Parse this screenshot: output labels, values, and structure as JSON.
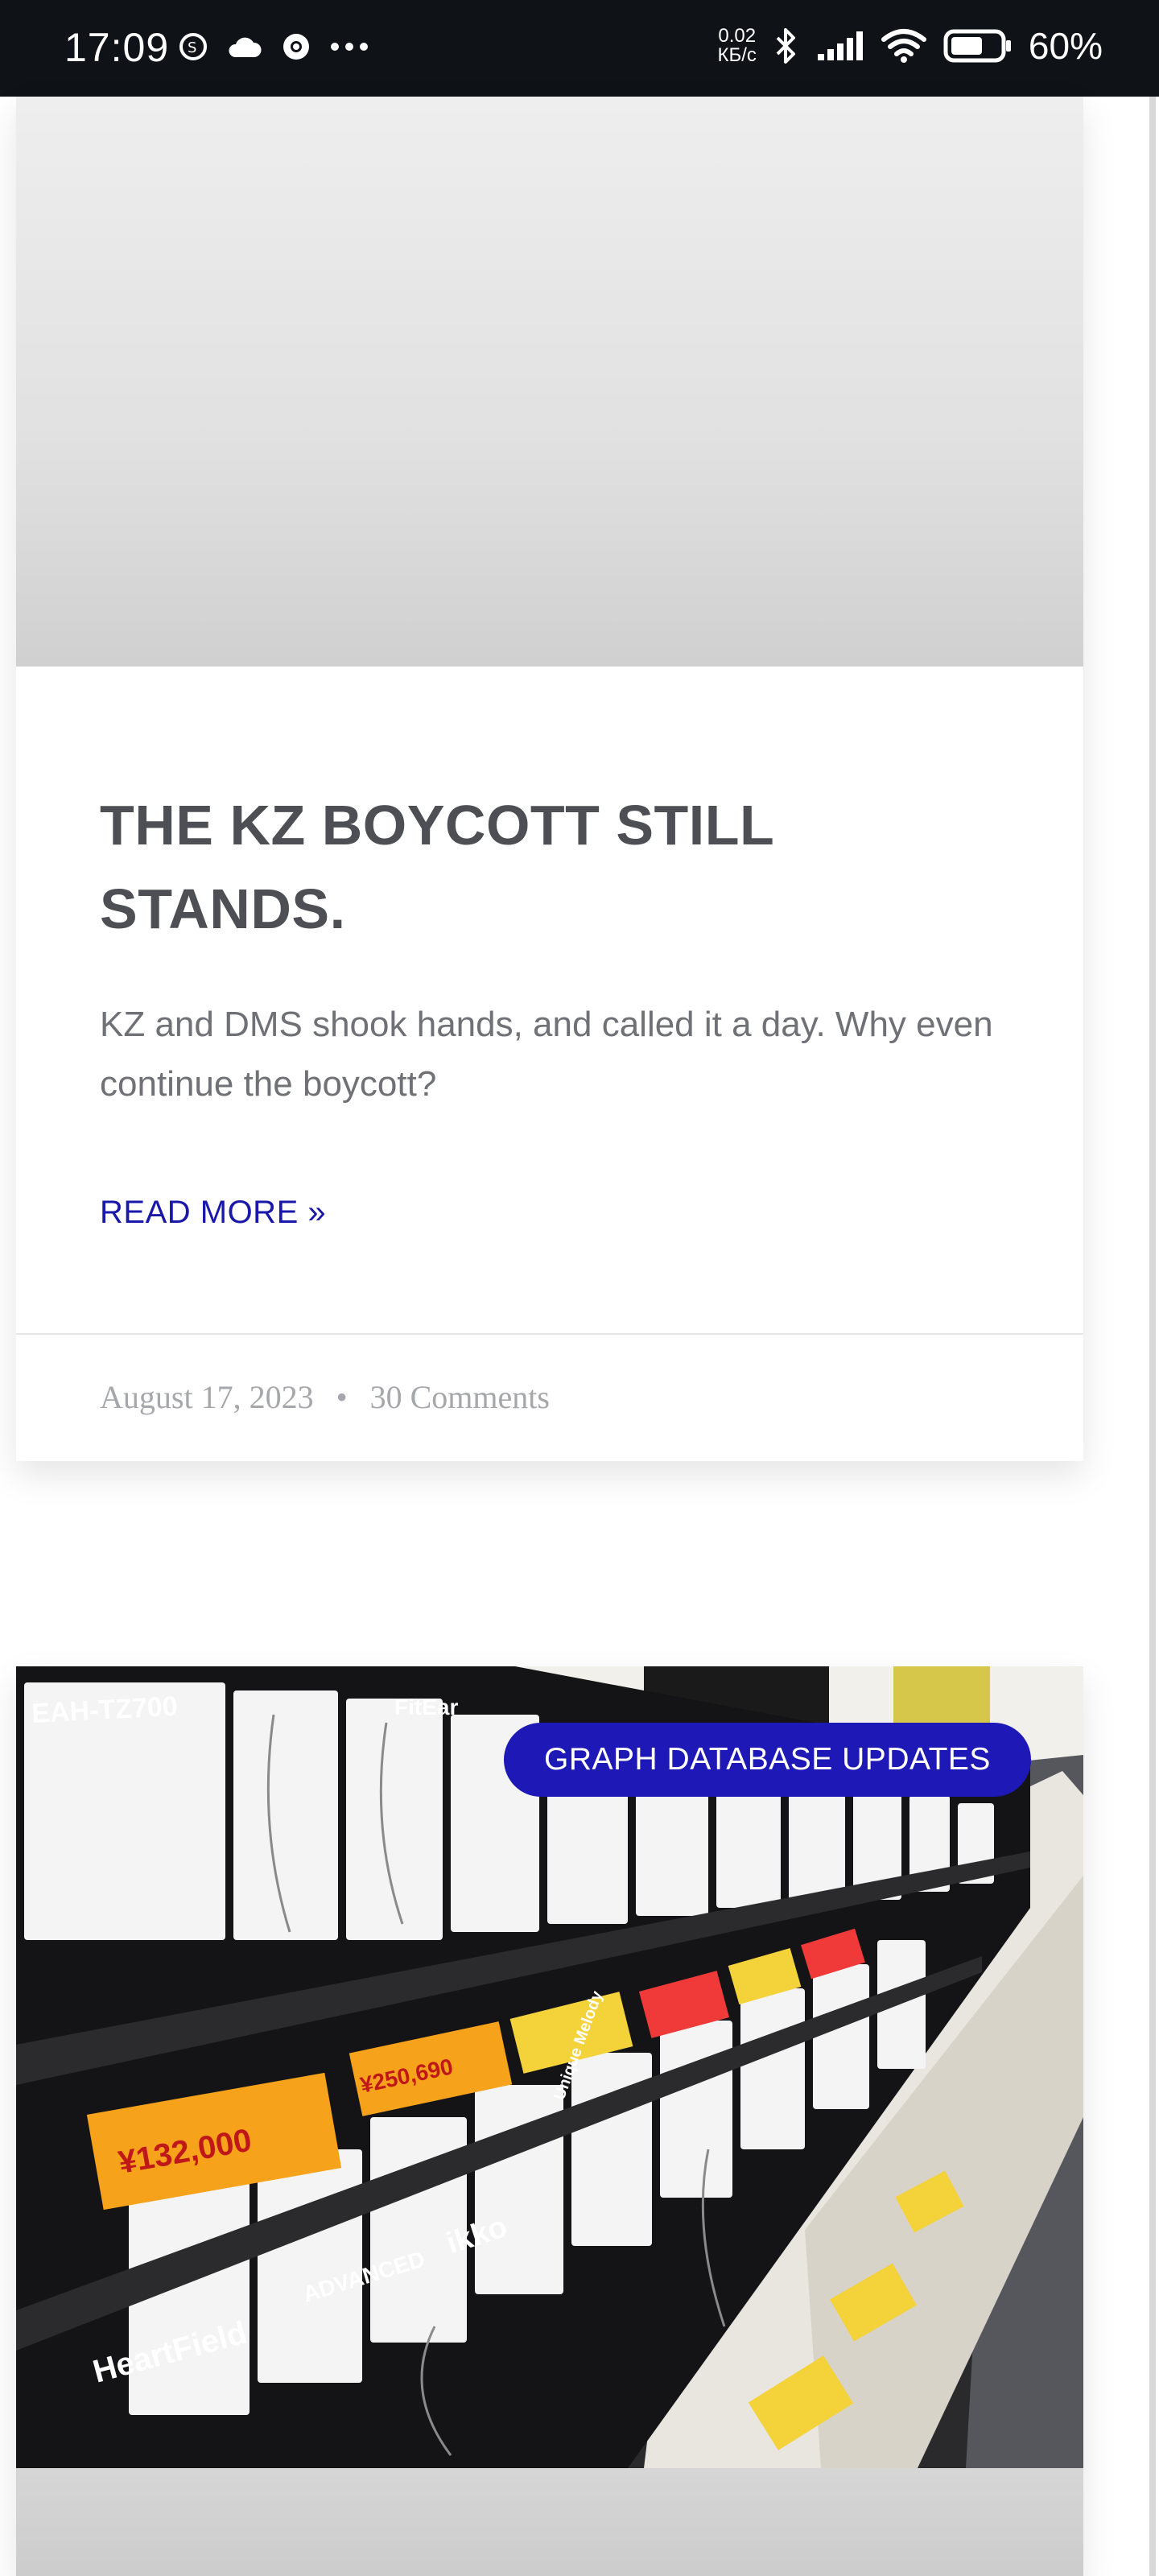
{
  "status_bar": {
    "time": "17:09",
    "net_speed_value": "0.02",
    "net_speed_unit": "КБ/с",
    "battery_pct": "60%",
    "icons": [
      "mastodon-icon",
      "cloud-icon",
      "chrome-icon",
      "more-dots-icon",
      "bluetooth-icon",
      "signal-icon",
      "wifi-icon",
      "battery-icon"
    ]
  },
  "post1": {
    "title": "THE KZ BOYCOTT STILL STANDS.",
    "excerpt": "KZ and DMS shook hands, and called it a day. Why even continue the boycott?",
    "read_more": "READ MORE »",
    "date": "August 17, 2023",
    "separator": "•",
    "comments": "30 Comments"
  },
  "post2": {
    "category": "GRAPH DATABASE UPDATES",
    "image_text": {
      "product": "EAH-TZ700",
      "price1": "¥132,000",
      "price2": "¥250,690",
      "brand1": "HeartField",
      "brand2": "ADVANCED",
      "brand3": "ikko",
      "brand4": "FitEar",
      "brand5": "Unique Melody"
    }
  },
  "colors": {
    "accent": "#1d18b6",
    "link": "#1a18a8",
    "title": "#4d4f55",
    "meta": "#a6a7aa"
  }
}
